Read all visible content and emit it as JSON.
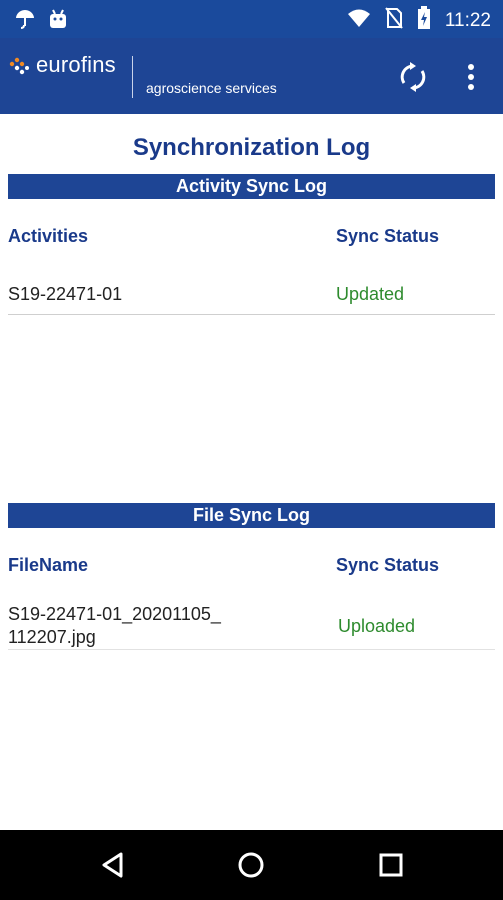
{
  "status_bar": {
    "time": "11:22",
    "left_icons": [
      "umbrella-icon",
      "android-icon"
    ],
    "right_icons": [
      "wifi-icon",
      "no-sim-icon",
      "battery-charging-icon"
    ]
  },
  "app_bar": {
    "brand": "eurofins",
    "sub_brand": "agroscience services",
    "actions": [
      "sync-icon",
      "more-vert-icon"
    ],
    "colors": {
      "bar": "#1e4595",
      "status": "#1a4a9c",
      "logo_orange": "#f08a24"
    }
  },
  "page": {
    "title": "Synchronization Log"
  },
  "activity_log": {
    "header": "Activity Sync Log",
    "columns": [
      "Activities",
      "Sync Status"
    ],
    "rows": [
      {
        "name": "S19-22471-01",
        "status": "Updated"
      }
    ]
  },
  "file_log": {
    "header": "File Sync Log",
    "columns": [
      "FileName",
      "Sync Status"
    ],
    "rows": [
      {
        "name_line1": "S19-22471-01_20201105_",
        "name_line2": "112207.jpg",
        "status": "Uploaded"
      }
    ]
  },
  "nav_bar": {
    "buttons": [
      "back-icon",
      "home-icon",
      "recents-icon"
    ]
  }
}
